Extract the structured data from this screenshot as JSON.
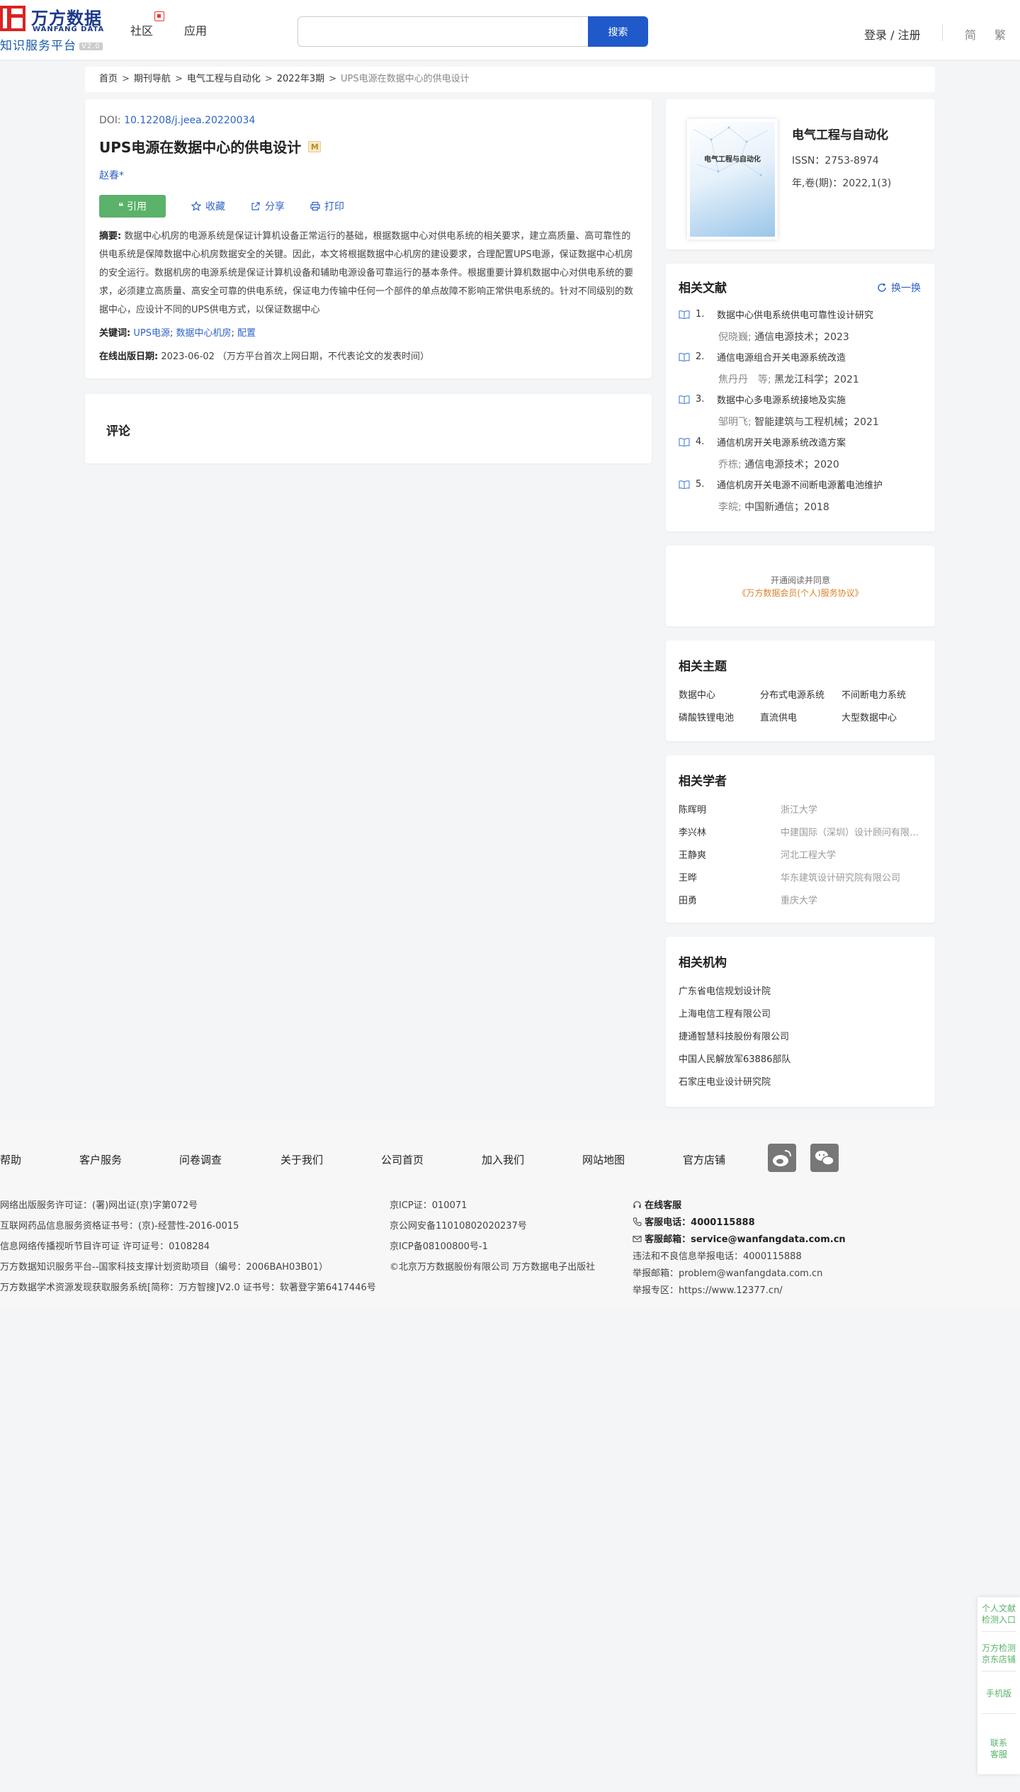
{
  "header": {
    "logo_cn": "万方数据",
    "logo_en": "WANFANG DATA",
    "logo_sub": "知识服务平台",
    "logo_ver": "V2.0",
    "nav": [
      "社区",
      "应用"
    ],
    "search_placeholder": "",
    "search_button": "搜索",
    "login": "登录 / 注册",
    "lang_simplified": "简",
    "lang_traditional": "繁"
  },
  "breadcrumb": {
    "items": [
      "首页",
      "期刊导航",
      "电气工程与自动化",
      "2022年3期"
    ],
    "current": "UPS电源在数据中心的供电设计",
    "separator": ">"
  },
  "article": {
    "doi_label": "DOI: ",
    "doi": "10.12208/j.jeea.20220034",
    "title": "UPS电源在数据中心的供电设计",
    "badge": "M",
    "author": "赵春*",
    "cite": "❝ 引用",
    "favorite": "收藏",
    "share": "分享",
    "print": "打印",
    "abstract_label": "摘要:",
    "abstract": "数据中心机房的电源系统是保证计算机设备正常运行的基础，根据数据中心对供电系统的相关要求，建立高质量、高可靠性的供电系统是保障数据中心机房数据安全的关键。因此，本文将根据数据中心机房的建设要求，合理配置UPS电源，保证数据中心机房的安全运行。数据机房的电源系统是保证计算机设备和辅助电源设备可靠运行的基本条件。根据重要计算机数据中心对供电系统的要求，必须建立高质量、高安全可靠的供电系统，保证电力传输中任何一个部件的单点故障不影响正常供电系统的。针对不同级别的数据中心，应设计不同的UPS供电方式，以保证数据中心",
    "keywords_label": "关键词:",
    "keywords": [
      "UPS电源",
      "数据中心机房",
      "配置"
    ],
    "pubdate_label": "在线出版日期:",
    "pubdate": "2023-06-02 （万方平台首次上网日期，不代表论文的发表时间）"
  },
  "comment": {
    "title": "评论"
  },
  "journal": {
    "cover_title": "电气工程与自动化",
    "name": "电气工程与自动化",
    "issn": "ISSN：2753-8974",
    "volume": "年,卷(期)：2022,1(3)"
  },
  "related_docs": {
    "title": "相关文献",
    "refresh": "换一换",
    "items": [
      {
        "num": "1.",
        "title": "数据中心供电系统供电可靠性设计研究",
        "author": "倪晓巍;",
        "source": " 通信电源技术；2023"
      },
      {
        "num": "2.",
        "title": "通信电源组合开关电源系统改造",
        "author": "焦丹丹　等;",
        "source": " 黑龙江科学；2021"
      },
      {
        "num": "3.",
        "title": "数据中心多电源系统接地及实施",
        "author": "邹明飞;",
        "source": " 智能建筑与工程机械；2021"
      },
      {
        "num": "4.",
        "title": "通信机房开关电源系统改造方案",
        "author": "乔栋;",
        "source": " 通信电源技术；2020"
      },
      {
        "num": "5.",
        "title": "通信机房开关电源不间断电源蓄电池维护",
        "author": "李皖;",
        "source": " 中国新通信；2018"
      }
    ]
  },
  "agreement": {
    "line1": "开通阅读并同意",
    "link": "《万方数据会员(个人)服务协议》"
  },
  "topics": {
    "title": "相关主题",
    "items": [
      "数据中心",
      "分布式电源系统",
      "不间断电力系统",
      "磷酸铁锂电池",
      "直流供电",
      "大型数据中心"
    ]
  },
  "scholars": {
    "title": "相关学者",
    "items": [
      {
        "name": "陈晖明",
        "org": "浙江大学"
      },
      {
        "name": "李兴林",
        "org": "中建国际（深圳）设计顾问有限公司"
      },
      {
        "name": "王静爽",
        "org": "河北工程大学"
      },
      {
        "name": "王晔",
        "org": "华东建筑设计研究院有限公司"
      },
      {
        "name": "田勇",
        "org": "重庆大学"
      }
    ]
  },
  "institutions": {
    "title": "相关机构",
    "items": [
      "广东省电信规划设计院",
      "上海电信工程有限公司",
      "捷通智慧科技股份有限公司",
      "中国人民解放军63886部队",
      "石家庄电业设计研究院"
    ]
  },
  "footer": {
    "nav": [
      "帮助",
      "客户服务",
      "问卷调查",
      "关于我们",
      "公司首页",
      "加入我们",
      "网站地图",
      "官方店铺"
    ],
    "col1": [
      "网络出版服务许可证：(署)网出证(京)字第072号",
      "互联网药品信息服务资格证书号：(京)-经营性-2016-0015",
      "信息网络传播视听节目许可证 许可证号：0108284",
      "万方数据知识服务平台--国家科技支撑计划资助项目（编号：2006BAH03B01）",
      "万方数据学术资源发现获取服务系统[简称：万方智搜]V2.0 证书号：软著登字第6417446号"
    ],
    "col2": [
      "京ICP证：010071",
      "京公网安备11010802020237号",
      "京ICP备08100800号-1",
      "©北京万方数据股份有限公司 万方数据电子出版社"
    ],
    "online": "在线客服",
    "phone_label": "客服电话：",
    "phone": "4000115888",
    "email_label": "客服邮箱：",
    "email": "service@wanfangdata.com.cn",
    "report_phone": "违法和不良信息举报电话：4000115888",
    "report_email": "举报邮箱：problem@wanfangdata.com.cn",
    "report_site": "举报专区：https://www.12377.cn/"
  },
  "floatbar": {
    "items": [
      "个人文献\n检测入口",
      "万方检测\n京东店铺",
      "手机版",
      "联系\n客服"
    ]
  }
}
